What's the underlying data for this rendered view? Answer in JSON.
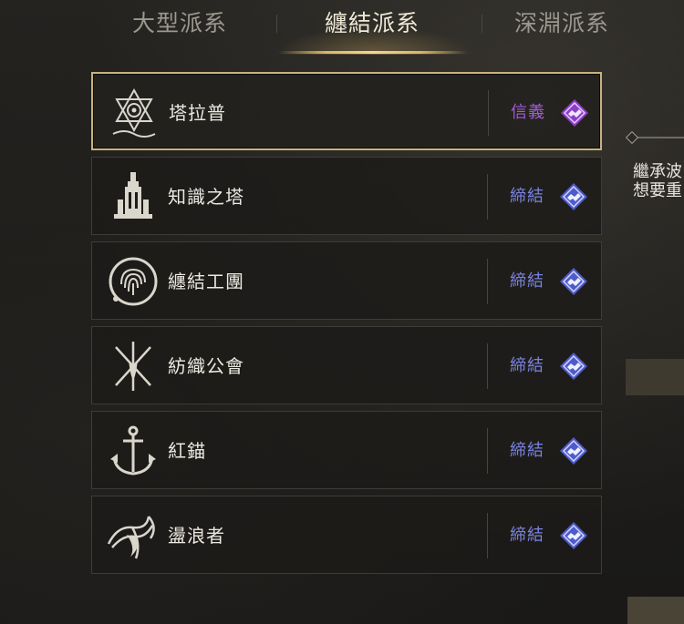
{
  "tabs": [
    {
      "label": "大型派系",
      "active": false
    },
    {
      "label": "纏結派系",
      "active": true
    },
    {
      "label": "深淵派系",
      "active": false
    }
  ],
  "factions": [
    {
      "name": "塔拉普",
      "status": "信義",
      "status_color": "#a55ad8",
      "selected": true,
      "emblem": "tarap-star-emblem-icon"
    },
    {
      "name": "知識之塔",
      "status": "締結",
      "status_color": "#7a83df",
      "selected": false,
      "emblem": "tower-of-knowledge-emblem-icon"
    },
    {
      "name": "纏結工團",
      "status": "締結",
      "status_color": "#7a83df",
      "selected": false,
      "emblem": "fingerprint-emblem-icon"
    },
    {
      "name": "紡織公會",
      "status": "締結",
      "status_color": "#7a83df",
      "selected": false,
      "emblem": "crossed-needles-emblem-icon"
    },
    {
      "name": "紅錨",
      "status": "締結",
      "status_color": "#7a83df",
      "selected": false,
      "emblem": "anchor-emblem-icon"
    },
    {
      "name": "盪浪者",
      "status": "締結",
      "status_color": "#7a83df",
      "selected": false,
      "emblem": "wave-emblem-icon"
    }
  ],
  "side_panel": {
    "line1": "繼承波",
    "line2": "想要重"
  },
  "colors": {
    "accent_gold": "#d8b667",
    "bond_blue": "#7a83df",
    "trust_purple": "#a55ad8"
  }
}
